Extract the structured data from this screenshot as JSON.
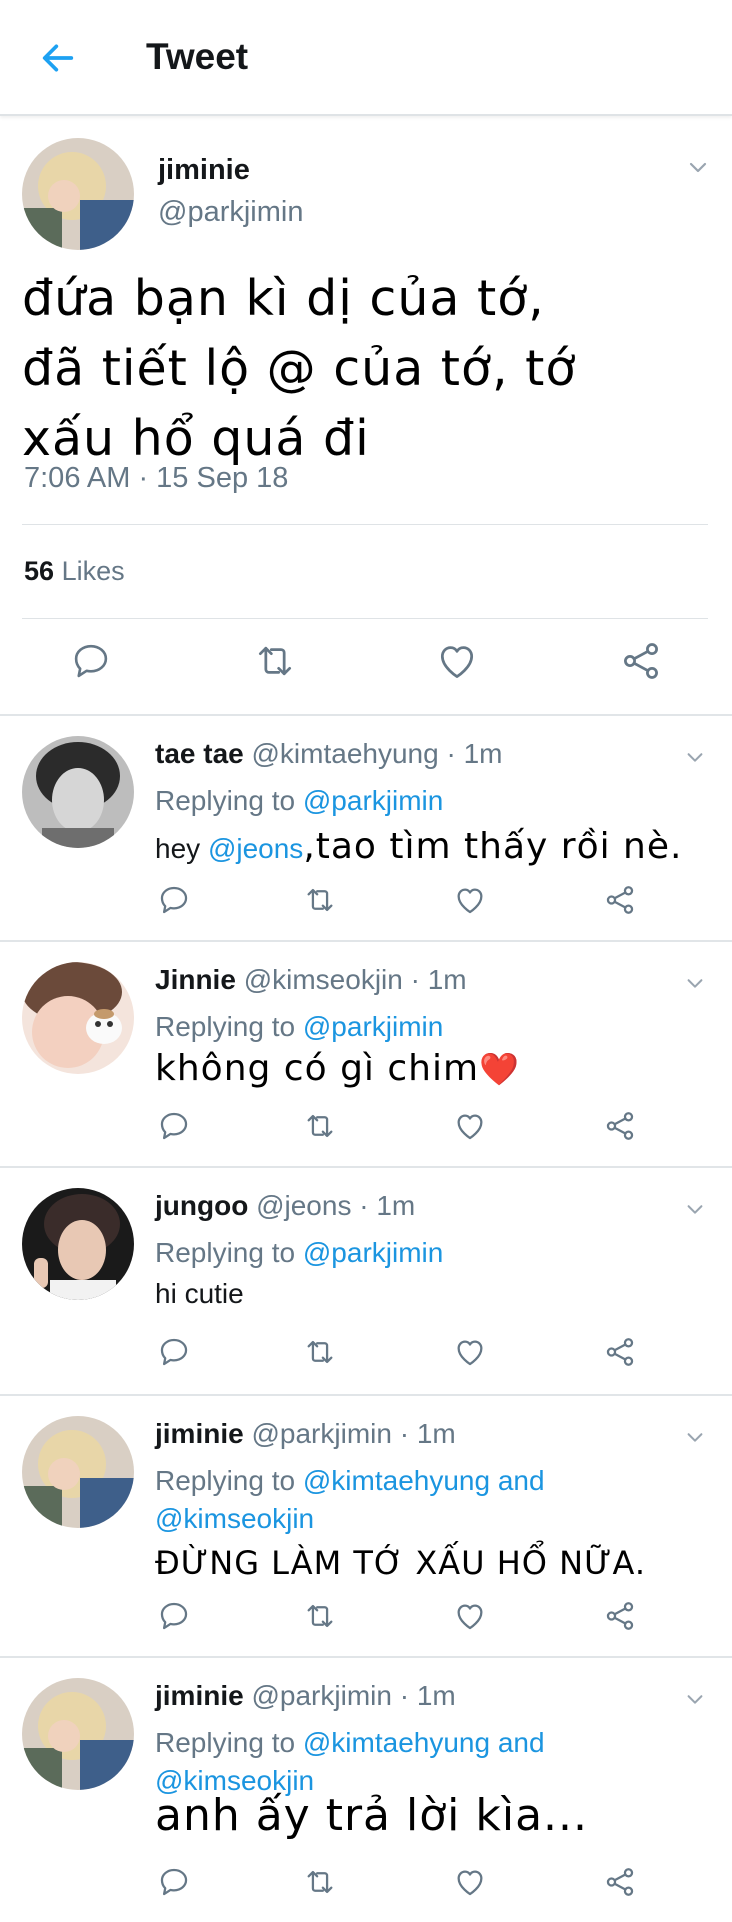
{
  "header": {
    "title": "Tweet"
  },
  "main_tweet": {
    "name": "jiminie",
    "handle": "@parkjimin",
    "text_line1": "đứa bạn kì dị của tớ,",
    "text_line2": "đã tiết lộ @ của tớ, tớ",
    "text_line3": "xấu hổ quá đi",
    "timestamp": "7:06 AM · 15 Sep 18",
    "likes_count": "56",
    "likes_label": "Likes"
  },
  "replies": [
    {
      "name": "tae tae",
      "meta": "@kimtaehyung · 1m",
      "replying_prefix": "Replying to",
      "replying_to": "@parkjimin",
      "replying_to2": "",
      "body_prefix": "hey ",
      "body_mention": "@jeons",
      "body_hand": ",tao tìm thấy rồi nè."
    },
    {
      "name": "Jinnie",
      "meta": "@kimseokjin · 1m",
      "replying_prefix": "Replying to",
      "replying_to": "@parkjimin",
      "body_hand": "không có gì chim",
      "body_emoji": "❤️"
    },
    {
      "name": "jungoo",
      "meta": "@jeons · 1m",
      "replying_prefix": "Replying to",
      "replying_to": "@parkjimin",
      "body_plain": "hi cutie"
    },
    {
      "name": "jiminie",
      "meta": "@parkjimin · 1m",
      "replying_prefix": "Replying to",
      "replying_to": "@kimtaehyung and",
      "replying_to2": "@kimseokjin",
      "body_hand": "ĐỪNG LÀM TỚ XẤU HỔ NỮA."
    },
    {
      "name": "jiminie",
      "meta": "@parkjimin · 1m",
      "replying_prefix": "Replying to",
      "replying_to": "@kimtaehyung and",
      "replying_to2": "@kimseokjin",
      "body_hand": "anh ấy trả lời kìa..."
    }
  ],
  "colors": {
    "accent": "#1b95e0",
    "secondary_text": "#657786",
    "divider": "#e1e5e8"
  },
  "icons": [
    "back-arrow-icon",
    "chevron-down-icon",
    "reply-icon",
    "retweet-icon",
    "like-icon",
    "share-icon"
  ]
}
